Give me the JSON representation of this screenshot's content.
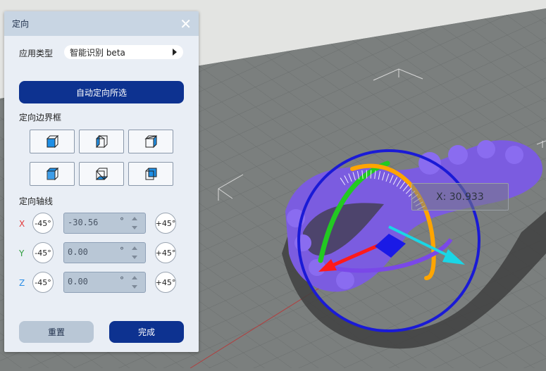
{
  "panel": {
    "title": "定向",
    "application_type_label": "应用类型",
    "application_type_value": "智能识别 beta",
    "auto_orient_label": "自动定向所选",
    "bbox_section_label": "定向边界框",
    "axis_section_label": "定向轴线",
    "axes": [
      {
        "name": "X",
        "minus_label": "-45°",
        "value": "-30.56",
        "unit": "°",
        "plus_label": "+45°",
        "color": "#e33b3b"
      },
      {
        "name": "Y",
        "minus_label": "-45°",
        "value": "0.00",
        "unit": "°",
        "plus_label": "+45°",
        "color": "#2e9e3e"
      },
      {
        "name": "Z",
        "minus_label": "-45°",
        "value": "0.00",
        "unit": "°",
        "plus_label": "+45°",
        "color": "#2e8fe6"
      }
    ],
    "reset_label": "重置",
    "done_label": "完成"
  },
  "viewport": {
    "tooltip": "X: 30.933"
  },
  "colors": {
    "primary": "#0d3290",
    "panel_bg": "#e9eef5",
    "header_bg": "#c8d5e3",
    "model": "#7b5ce0",
    "grid_bg": "#7b7f7e"
  }
}
